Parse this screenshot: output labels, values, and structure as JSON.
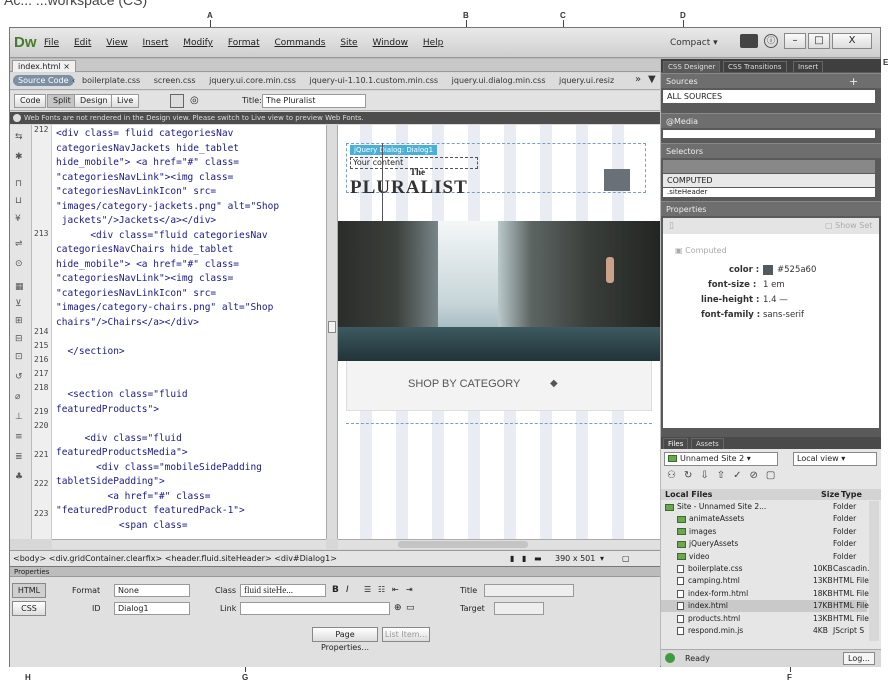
{
  "caption_partial": "Ac... ...workspace (CS)",
  "callouts": {
    "a": "A",
    "b": "B",
    "c": "C",
    "d": "D",
    "e": "E",
    "f": "F",
    "g": "G",
    "h": "H"
  },
  "app": {
    "logo": "Dw",
    "menu": [
      "File",
      "Edit",
      "View",
      "Insert",
      "Modify",
      "Format",
      "Commands",
      "Site",
      "Window",
      "Help"
    ],
    "workspace": "Compact",
    "window_buttons": [
      "–",
      "□",
      "X"
    ]
  },
  "document": {
    "tab": "index.html",
    "source_code": "Source Code",
    "related_files": [
      "boilerplate.css",
      "screen.css",
      "jquery.ui.core.min.css",
      "jquery-ui-1.10.1.custom.min.css",
      "jquery.ui.dialog.min.css",
      "jquery.ui.resiz"
    ],
    "views": [
      "Code",
      "Split",
      "Design",
      "Live"
    ],
    "title_label": "Title:",
    "title_value": "The Pluralist",
    "warning": "Web Fonts are not rendered in the Design view. Please switch to Live view to preview Web Fonts.",
    "line_numbers": [
      "212",
      "213",
      "214",
      "215",
      "216",
      "217",
      "218",
      "219",
      "220",
      "221",
      "222",
      "223"
    ],
    "code_lines": [
      "<div class= fluid categoriesNav",
      "categoriesNavJackets hide_tablet",
      "hide_mobile\"> <a href=\"#\" class=",
      "\"categoriesNavLink\"><img class=",
      "\"categoriesNavLinkIcon\" src=",
      "\"images/category-jackets.png\" alt=\"Shop",
      " jackets\"/>Jackets</a></div>",
      "      <div class=\"fluid categoriesNav",
      "categoriesNavChairs hide_tablet",
      "hide_mobile\"> <a href=\"#\" class=",
      "\"categoriesNavLink\"><img class=",
      "\"categoriesNavLinkIcon\" src=",
      "\"images/category-chairs.png\" alt=\"Shop",
      "chairs\"/>Chairs</a></div>",
      "",
      "  </section>",
      "",
      "",
      "  <section class=\"fluid",
      "featuredProducts\">",
      "",
      "     <div class=\"fluid",
      "featuredProductsMedia\">",
      "       <div class=\"mobileSidePadding",
      "tabletSidePadding\">",
      "         <a href=\"#\" class=",
      "\"featuredProduct featuredPack-1\">",
      "           <span class="
    ],
    "design": {
      "jquery_badge": "jQuery Dialog: Dialog1",
      "your_content": "Your content",
      "brand_the": "The",
      "brand_name": "PLURALIST",
      "shop": "SHOP BY CATEGORY"
    },
    "status": {
      "tag_path": "<body> <div.gridContainer.clearfix> <header.fluid.siteHeader> <div#Dialog1>",
      "size": "390 x 501"
    }
  },
  "properties": {
    "title": "Properties",
    "html_btn": "HTML",
    "css_btn": "CSS",
    "format_label": "Format",
    "format_value": "None",
    "class_label": "Class",
    "class_value": "fluid siteHe...",
    "id_label": "ID",
    "id_value": "Dialog1",
    "link_label": "Link",
    "title_label": "Title",
    "target_label": "Target",
    "page_properties": "Page Properties...",
    "list_item": "List Item..."
  },
  "panels": {
    "tabs": [
      "CSS Designer",
      "CSS Transitions",
      "Insert"
    ],
    "sources_label": "Sources",
    "all_sources": "ALL SOURCES",
    "media_label": "@Media",
    "selectors_label": "Selectors",
    "computed": "COMPUTED",
    "site_header": ".siteHeader",
    "properties_label": "Properties",
    "show_set": "Show Set",
    "computed_label": "Computed",
    "css_props": [
      {
        "name": "color :",
        "value": "#525a60"
      },
      {
        "name": "font-size :",
        "value": "1 em"
      },
      {
        "name": "line-height :",
        "value": "1.4 —"
      },
      {
        "name": "font-family :",
        "value": "sans-serif"
      }
    ],
    "files_tabs": [
      "Files",
      "Assets"
    ],
    "site_select": "Unnamed Site 2",
    "view_select": "Local view",
    "local_files": "Local Files",
    "size_col": "Size",
    "type_col": "Type",
    "files": [
      {
        "name": "Site - Unnamed Site 2...",
        "size": "",
        "type": "Folder",
        "kind": "folder"
      },
      {
        "name": "animateAssets",
        "size": "",
        "type": "Folder",
        "kind": "folder"
      },
      {
        "name": "images",
        "size": "",
        "type": "Folder",
        "kind": "folder"
      },
      {
        "name": "jQueryAssets",
        "size": "",
        "type": "Folder",
        "kind": "folder"
      },
      {
        "name": "video",
        "size": "",
        "type": "Folder",
        "kind": "folder"
      },
      {
        "name": "boilerplate.css",
        "size": "10KB",
        "type": "Cascadin..",
        "kind": "file"
      },
      {
        "name": "camping.html",
        "size": "13KB",
        "type": "HTML File",
        "kind": "file"
      },
      {
        "name": "index-form.html",
        "size": "18KB",
        "type": "HTML File",
        "kind": "file"
      },
      {
        "name": "index.html",
        "size": "17KB",
        "type": "HTML File",
        "kind": "file"
      },
      {
        "name": "products.html",
        "size": "13KB",
        "type": "HTML File",
        "kind": "file"
      },
      {
        "name": "respond.min.js",
        "size": "4KB",
        "type": "JScript S",
        "kind": "file"
      }
    ],
    "ready": "Ready",
    "log": "Log..."
  }
}
